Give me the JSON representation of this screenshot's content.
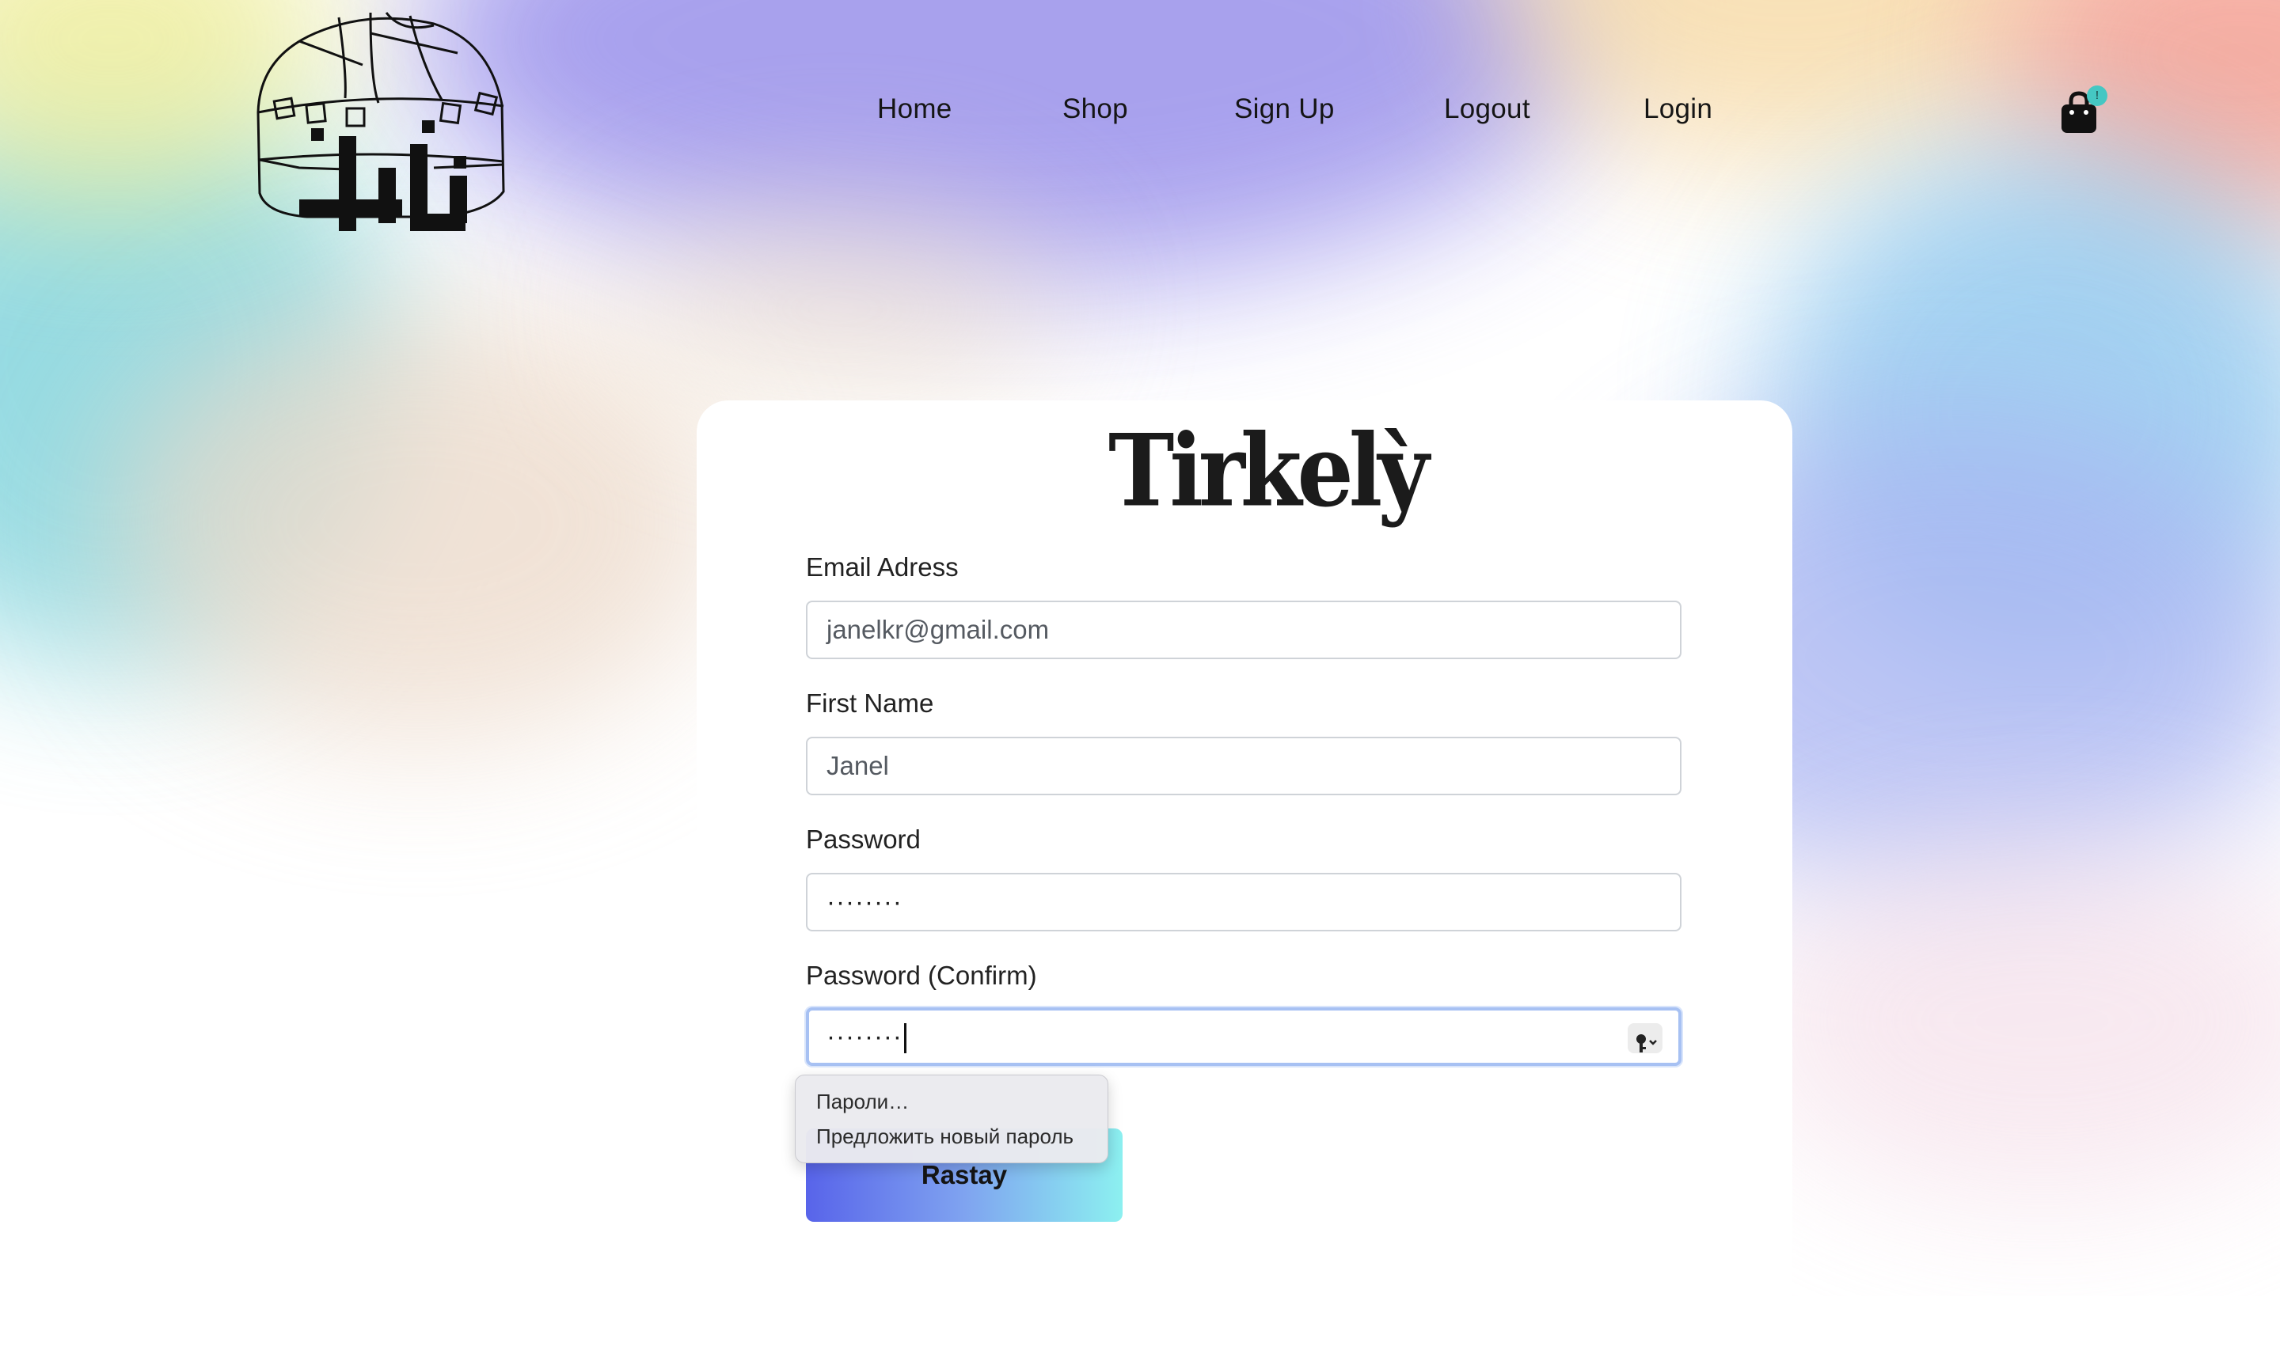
{
  "nav": {
    "home": "Home",
    "shop": "Shop",
    "signup": "Sign Up",
    "logout": "Logout",
    "login": "Login"
  },
  "cart": {
    "badge": "!",
    "icon": "shopping-bag-icon"
  },
  "logo": {
    "icon": "yurt-logo"
  },
  "form": {
    "brand": "Tirkelỳ",
    "email": {
      "label": "Email Adress",
      "value": "janelkr@gmail.com"
    },
    "first_name": {
      "label": "First Name",
      "value": "Janel"
    },
    "password": {
      "label": "Password",
      "value": "········"
    },
    "password_confirm": {
      "label": "Password (Confirm)",
      "value": "········"
    },
    "submit_label": "Rastay"
  },
  "password_menu": {
    "items": [
      "Пароли…",
      "Предложить новый пароль"
    ]
  },
  "colors": {
    "button_gradient_start": "#5864ea",
    "button_gradient_end": "#8cf0f0",
    "badge": "#45c7c3",
    "focus_ring": "#a7c1f3"
  }
}
